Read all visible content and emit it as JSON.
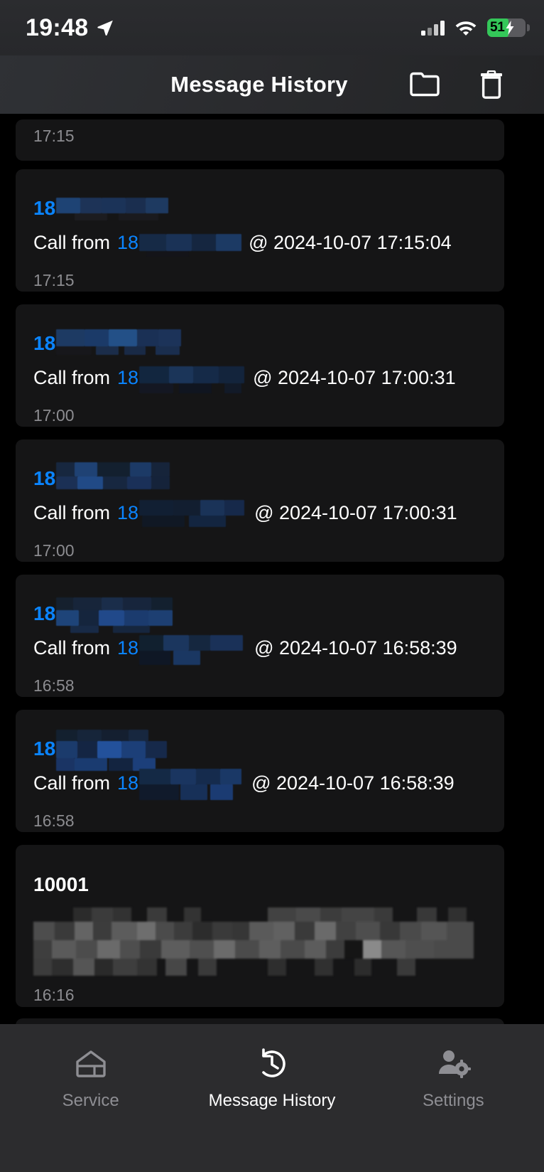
{
  "status_bar": {
    "time": "19:48",
    "location_icon": "location-arrow-icon",
    "cellular_icon": "cellular-bars-icon",
    "wifi_icon": "wifi-icon",
    "battery_percent": "51",
    "battery_charging": true,
    "battery_color": "#34c759"
  },
  "header": {
    "title": "Message History",
    "folder_icon": "folder-icon",
    "trash_icon": "trash-icon"
  },
  "theme": {
    "background": "#000000",
    "card_background": "#151516",
    "accent_blue": "#0a84ff",
    "muted_text": "#8c8c90",
    "tabbar_background": "#2c2c2e"
  },
  "messages": [
    {
      "id": "row-partial-top",
      "title": "",
      "title_redacted": false,
      "body_prefix": "",
      "body_number": "",
      "body_suffix": "",
      "time": "17:15",
      "partial": true
    },
    {
      "id": "row-1",
      "title": "18",
      "title_redacted": true,
      "body_prefix": "Call from",
      "body_number": "18",
      "body_suffix": "@ 2024-10-07 17:15:04",
      "time": "17:15",
      "partial": false
    },
    {
      "id": "row-2",
      "title": "18",
      "title_redacted": true,
      "body_prefix": "Call from",
      "body_number": "18",
      "body_suffix": "@ 2024-10-07 17:00:31",
      "time": "17:00",
      "partial": false
    },
    {
      "id": "row-3",
      "title": "18",
      "title_redacted": true,
      "body_prefix": "Call from",
      "body_number": "18",
      "body_suffix": "@ 2024-10-07 17:00:31",
      "time": "17:00",
      "partial": false
    },
    {
      "id": "row-4",
      "title": "18",
      "title_redacted": true,
      "body_prefix": "Call from",
      "body_number": "18",
      "body_suffix": "@ 2024-10-07 16:58:39",
      "time": "16:58",
      "partial": false
    },
    {
      "id": "row-5",
      "title": "18",
      "title_redacted": true,
      "body_prefix": "Call from",
      "body_number": "18",
      "body_suffix": "@ 2024-10-07 16:58:39",
      "time": "16:58",
      "partial": false
    },
    {
      "id": "row-6",
      "title": "10001",
      "title_redacted": false,
      "body_prefix": "",
      "body_number": "",
      "body_suffix": "",
      "body_blurred": true,
      "time": "16:16",
      "partial": false
    }
  ],
  "tabs": [
    {
      "label": "Service",
      "icon": "home-icon",
      "active": false
    },
    {
      "label": "Message History",
      "icon": "clock-history-icon",
      "active": true
    },
    {
      "label": "Settings",
      "icon": "user-gear-icon",
      "active": false
    }
  ]
}
